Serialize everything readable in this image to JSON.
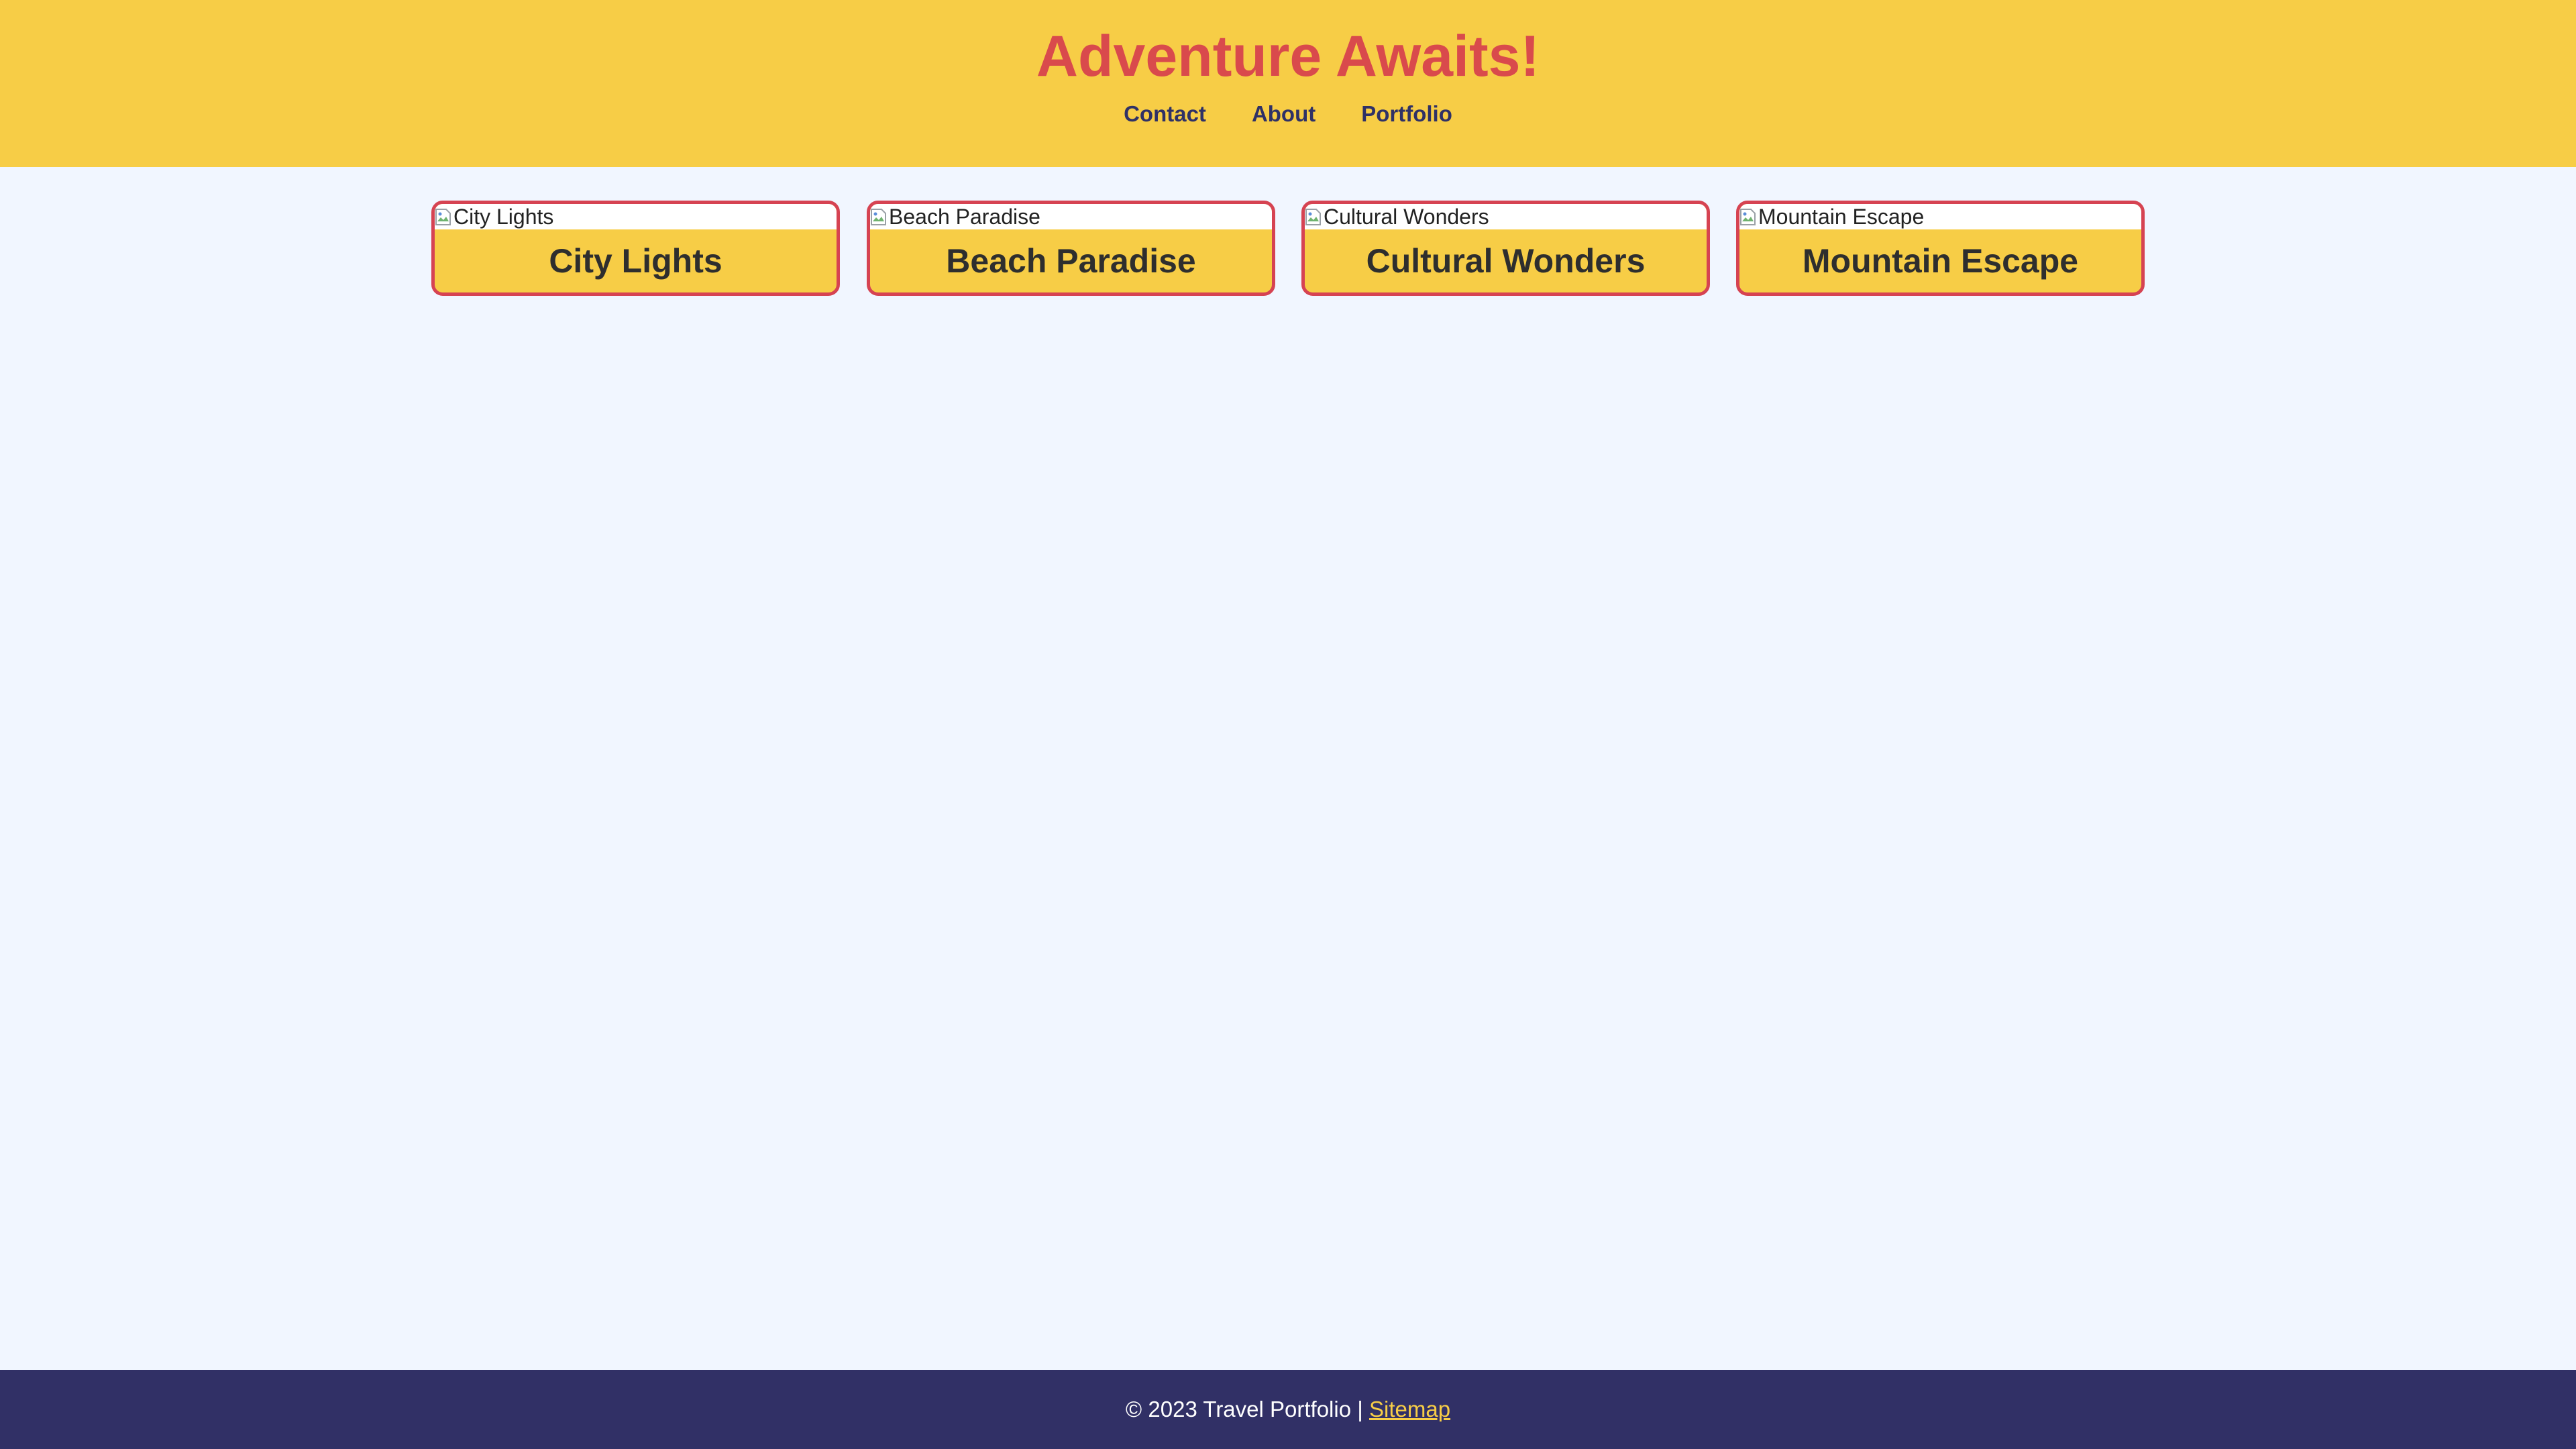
{
  "header": {
    "title": "Adventure Awaits!",
    "nav": [
      {
        "label": "Contact"
      },
      {
        "label": "About"
      },
      {
        "label": "Portfolio"
      }
    ]
  },
  "cards": [
    {
      "image_alt": "City Lights",
      "title": "City Lights"
    },
    {
      "image_alt": "Beach Paradise",
      "title": "Beach Paradise"
    },
    {
      "image_alt": "Cultural Wonders",
      "title": "Cultural Wonders"
    },
    {
      "image_alt": "Mountain Escape",
      "title": "Mountain Escape"
    }
  ],
  "footer": {
    "copyright": "© 2023 Travel Portfolio | ",
    "sitemap_label": "Sitemap"
  },
  "colors": {
    "header_bg": "#f7cd46",
    "title": "#d94a4c",
    "nav_text": "#2f3166",
    "page_bg": "#f1f6ff",
    "card_border": "#d64352",
    "footer_bg": "#313066",
    "footer_link": "#f7cd46"
  },
  "icons": {
    "card_image": "broken-image-icon"
  }
}
